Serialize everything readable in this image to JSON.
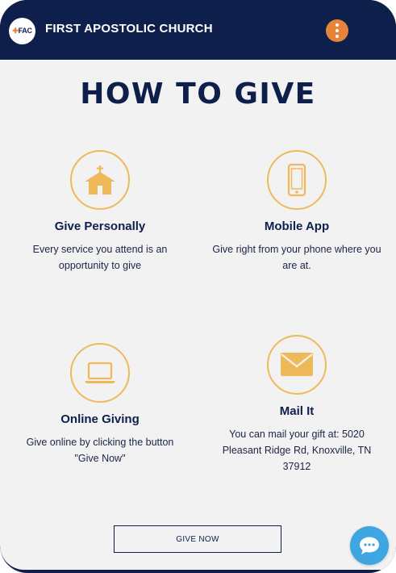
{
  "header": {
    "logo_text": "FAC",
    "site_title": "FIRST APOSTOLIC CHURCH",
    "menu_icon": "kebab-menu-icon"
  },
  "main": {
    "title": "HOW TO GIVE",
    "items": [
      {
        "icon": "church-icon",
        "title": "Give Personally",
        "description": "Every service you attend is an opportunity to give"
      },
      {
        "icon": "phone-icon",
        "title": "Mobile App",
        "description": "Give right from your phone where you are at."
      },
      {
        "icon": "laptop-icon",
        "title": "Online Giving",
        "description": "Give online by clicking the button \"Give Now\""
      },
      {
        "icon": "mail-icon",
        "title": "Mail It",
        "description": "You can mail your gift at: 5020 Pleasant Ridge Rd, Knoxville, TN 37912"
      }
    ],
    "give_button_label": "GIVE NOW"
  },
  "chat": {
    "icon": "chat-bubble-icon"
  },
  "colors": {
    "navy": "#0e1f4b",
    "orange": "#e8833a",
    "gold": "#efb95a",
    "chat_blue": "#3ea7e1",
    "background": "#f2f2f3"
  }
}
